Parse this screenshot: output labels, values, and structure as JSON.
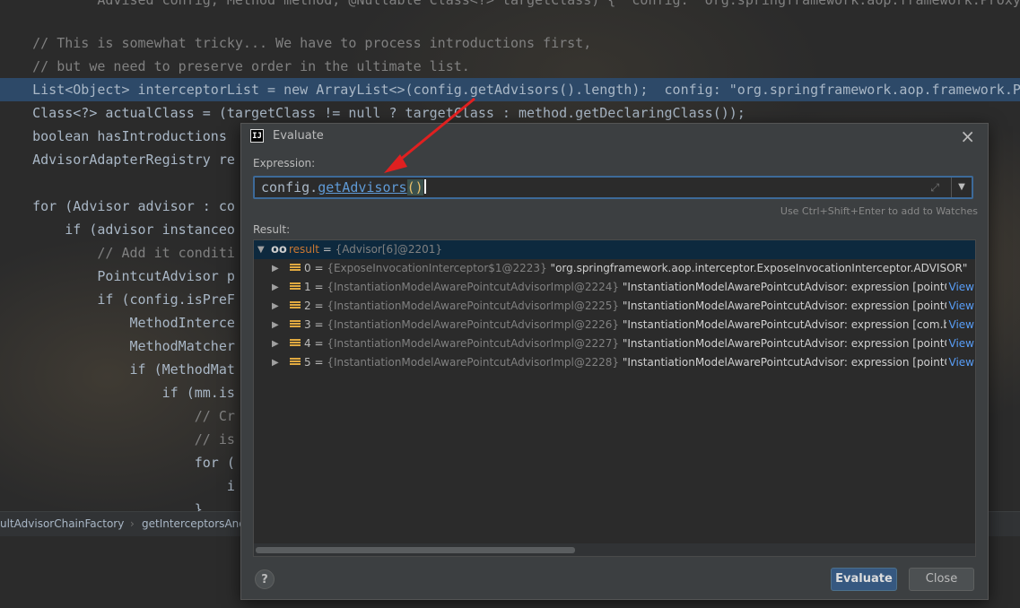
{
  "editor": {
    "lines": [
      {
        "text": "        Advised config, Method method, @Nullable Class<?> targetClass) {  config: \"org.springframework.aop.framework.ProxyFac"
      },
      {
        "text": ""
      },
      {
        "text": "    // This is somewhat tricky... We have to process introductions first,"
      },
      {
        "text": "    // but we need to preserve order in the ultimate list."
      },
      {
        "text": "    List<Object> interceptorList = new ArrayList<>(config.getAdvisors().length);  config: \"org.springframework.aop.framework.P"
      },
      {
        "text": "    Class<?> actualClass = (targetClass != null ? targetClass : method.getDeclaringClass());"
      },
      {
        "text": "    boolean hasIntroductions"
      },
      {
        "text": "    AdvisorAdapterRegistry re"
      },
      {
        "text": ""
      },
      {
        "text": "    for (Advisor advisor : co"
      },
      {
        "text": "        if (advisor instanceo"
      },
      {
        "text": "            // Add it conditi"
      },
      {
        "text": "            PointcutAdvisor p"
      },
      {
        "text": "            if (config.isPreF"
      },
      {
        "text": "                MethodInterce"
      },
      {
        "text": "                MethodMatcher"
      },
      {
        "text": "                if (MethodMat"
      },
      {
        "text": "                    if (mm.is"
      },
      {
        "text": "                        // Cr"
      },
      {
        "text": "                        // is"
      },
      {
        "text": "                        for ("
      },
      {
        "text": "                            i"
      },
      {
        "text": "                        }"
      }
    ],
    "breadcrumbs": [
      "ultAdvisorChainFactory",
      "getInterceptorsAnd"
    ]
  },
  "dialog": {
    "title": "Evaluate",
    "app_icon": "IJ",
    "expression_label": "Expression:",
    "expression": {
      "target": "config.",
      "method": "getAdvisors",
      "parens": "()"
    },
    "watch_hint": "Use Ctrl+Shift+Enter to add to Watches",
    "result_label": "Result:",
    "result": {
      "name": "result",
      "type": "{Advisor[6]@2201}"
    },
    "items": [
      {
        "index": "0",
        "type": "{ExposeInvocationInterceptor$1@2223}",
        "value": "\"org.springframework.aop.interceptor.ExposeInvocationInterceptor.ADVISOR\"",
        "view": ""
      },
      {
        "index": "1",
        "type": "{InstantiationModelAwarePointcutAdvisorImpl@2224}",
        "value": "\"InstantiationModelAwarePointcutAdvisor: expression [pointCut... ",
        "view": "View"
      },
      {
        "index": "2",
        "type": "{InstantiationModelAwarePointcutAdvisorImpl@2225}",
        "value": "\"InstantiationModelAwarePointcutAdvisor: expression [pointCut... ",
        "view": "View"
      },
      {
        "index": "3",
        "type": "{InstantiationModelAwarePointcutAdvisorImpl@2226}",
        "value": "\"InstantiationModelAwarePointcutAdvisor: expression [com.ber... ",
        "view": "View"
      },
      {
        "index": "4",
        "type": "{InstantiationModelAwarePointcutAdvisorImpl@2227}",
        "value": "\"InstantiationModelAwarePointcutAdvisor: expression [pointCut... ",
        "view": "View"
      },
      {
        "index": "5",
        "type": "{InstantiationModelAwarePointcutAdvisorImpl@2228}",
        "value": "\"InstantiationModelAwarePointcutAdvisor: expression [pointCut... ",
        "view": "View"
      }
    ],
    "help_label": "?",
    "evaluate_label": "Evaluate",
    "close_label": "Close",
    "close_icon": "×"
  },
  "colors": {
    "accent": "#365880",
    "highlight_line": "#2d4968",
    "arrow": "#e02020"
  }
}
